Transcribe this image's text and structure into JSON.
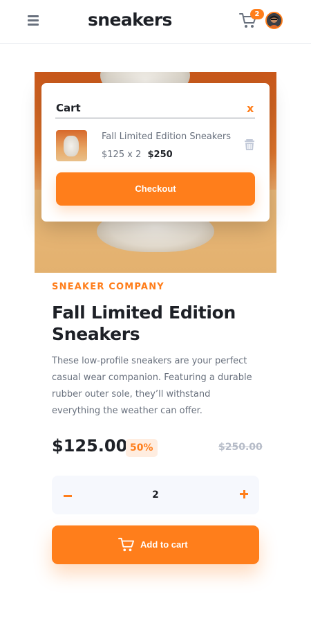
{
  "header": {
    "logo_text": "sneakers",
    "cart_count": "2",
    "icons": {
      "menu": "menu-icon",
      "cart": "cart-icon",
      "avatar": "avatar"
    }
  },
  "cart": {
    "title": "Cart",
    "close_label": "x",
    "item": {
      "name": "Fall Limited Edition Sneakers",
      "unit_price": "$125",
      "times": "x",
      "quantity": "2",
      "total": "$250"
    },
    "checkout_label": "Checkout",
    "icons": {
      "delete": "trash-icon"
    }
  },
  "product": {
    "company": "SNEAKER COMPANY",
    "title": "Fall Limited Edition Sneakers",
    "description": "These low-profile sneakers are your perfect casual wear companion. Featuring a durable rubber outer sole, they’ll withstand everything the weather can offer.",
    "price": "$125.00",
    "discount": "50%",
    "old_price": "$250.00"
  },
  "quantity_selector": {
    "value": "2",
    "minus_icon": "minus-icon",
    "plus_icon": "plus-icon"
  },
  "add_to_cart": {
    "label": "Add to cart",
    "icon": "cart-icon"
  },
  "colors": {
    "accent": "#ff7e1b",
    "accent_pale": "#ffede0",
    "text_dark": "#1d2026",
    "text_gray": "#68707d",
    "text_light": "#b6bcc8",
    "qty_bg": "#f6f8fd"
  }
}
